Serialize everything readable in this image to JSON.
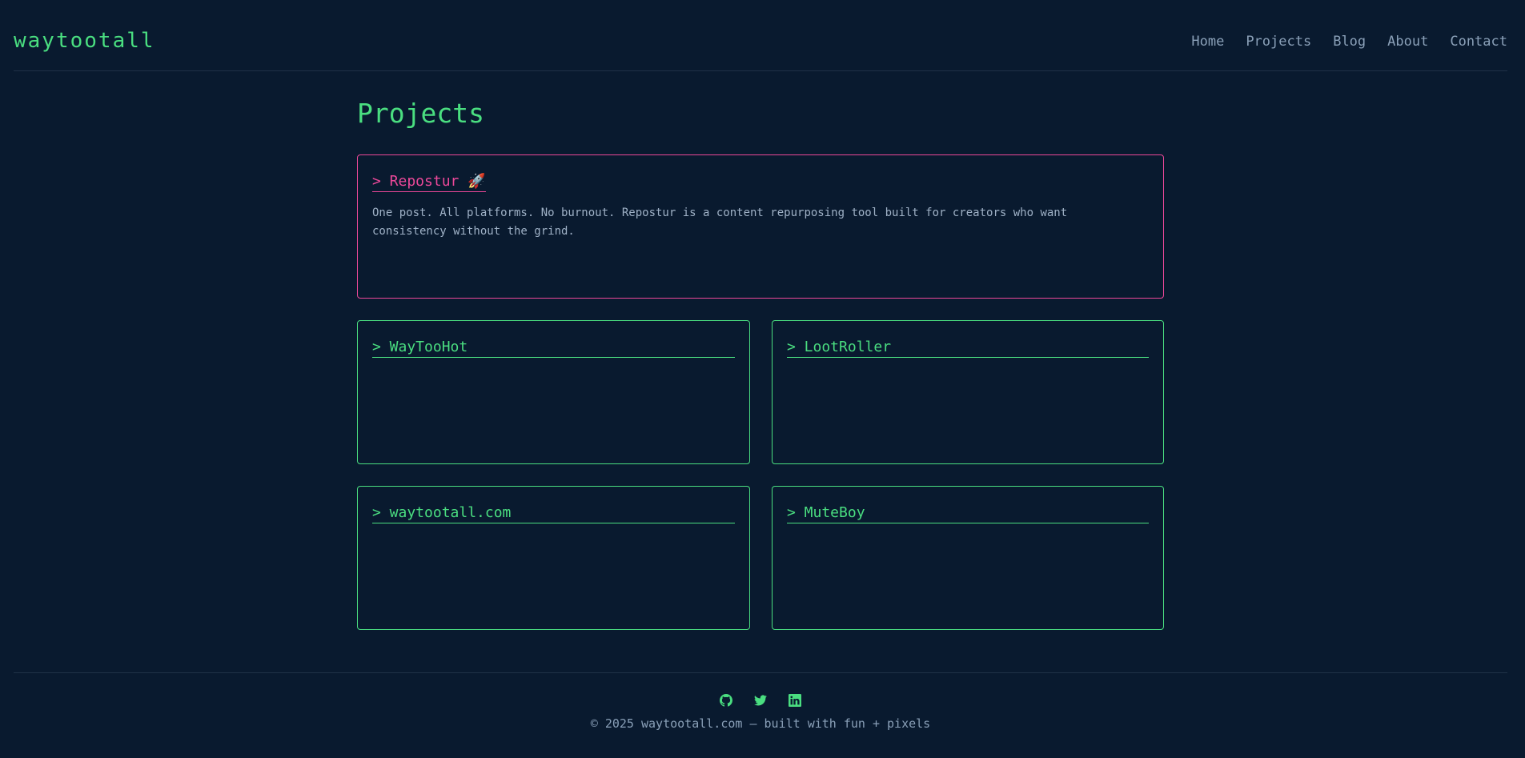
{
  "site": {
    "logo": "waytootall"
  },
  "nav": {
    "items": [
      "Home",
      "Projects",
      "Blog",
      "About",
      "Contact"
    ]
  },
  "main": {
    "title": "Projects",
    "featured": {
      "title": "> Repostur 🚀",
      "description": "One post. All platforms. No burnout. Repostur is a content repurposing tool built for creators who want consistency without the grind."
    },
    "projects": [
      {
        "title": "> WayTooHot"
      },
      {
        "title": "> LootRoller"
      },
      {
        "title": "> waytootall.com"
      },
      {
        "title": "> MuteBoy"
      }
    ]
  },
  "footer": {
    "socials": [
      "github-icon",
      "twitter-icon",
      "linkedin-icon"
    ],
    "copyright": "© 2025 waytootall.com — built with fun + pixels"
  },
  "colors": {
    "background": "#091a2f",
    "accent_green": "#4ade80",
    "accent_pink": "#ec4899",
    "muted_text": "#8aa0b8"
  }
}
